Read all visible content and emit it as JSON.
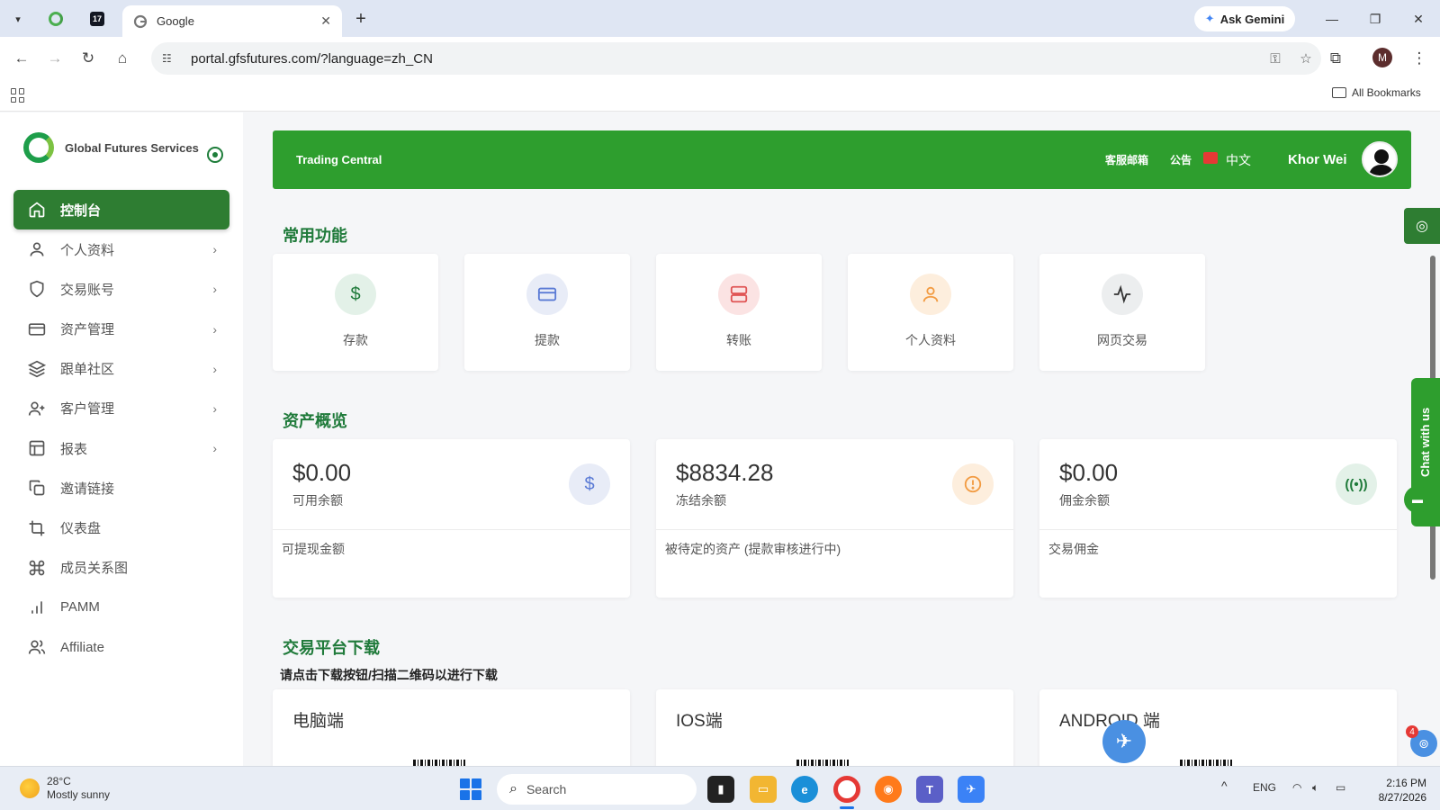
{
  "browser": {
    "active_tab_title": "Google",
    "new_tab_label": "+",
    "close_tab_label": "✕",
    "ask_gemini_label": "Ask Gemini",
    "url": "portal.gfsfutures.com/?language=zh_CN",
    "profile_initial": "M",
    "all_bookmarks_label": "All Bookmarks"
  },
  "sidebar": {
    "brand_name": "Global Futures Services",
    "items": [
      {
        "label": "控制台",
        "icon": "home-icon",
        "active": true,
        "has_chevron": false
      },
      {
        "label": "个人资料",
        "icon": "user-icon",
        "active": false,
        "has_chevron": true
      },
      {
        "label": "交易账号",
        "icon": "shield-icon",
        "active": false,
        "has_chevron": true
      },
      {
        "label": "资产管理",
        "icon": "credit-card-icon",
        "active": false,
        "has_chevron": true
      },
      {
        "label": "跟单社区",
        "icon": "layers-icon",
        "active": false,
        "has_chevron": true
      },
      {
        "label": "客户管理",
        "icon": "user-plus-icon",
        "active": false,
        "has_chevron": true
      },
      {
        "label": "报表",
        "icon": "table-icon",
        "active": false,
        "has_chevron": true
      },
      {
        "label": "邀请链接",
        "icon": "copy-icon",
        "active": false,
        "has_chevron": false
      },
      {
        "label": "仪表盘",
        "icon": "crop-icon",
        "active": false,
        "has_chevron": false
      },
      {
        "label": "成员关系图",
        "icon": "command-icon",
        "active": false,
        "has_chevron": false
      },
      {
        "label": "PAMM",
        "icon": "bar-chart-icon",
        "active": false,
        "has_chevron": false
      },
      {
        "label": "Affiliate",
        "icon": "users-icon",
        "active": false,
        "has_chevron": false
      }
    ]
  },
  "header": {
    "title": "Trading Central",
    "support_email_label": "客服邮箱",
    "announcement_label": "公告",
    "language_label": "中文",
    "username": "Khor Wei"
  },
  "quick_functions": {
    "title": "常用功能",
    "items": [
      {
        "label": "存款",
        "icon": "dollar-icon"
      },
      {
        "label": "提款",
        "icon": "credit-card-icon"
      },
      {
        "label": "转账",
        "icon": "server-icon"
      },
      {
        "label": "个人资料",
        "icon": "user-icon"
      },
      {
        "label": "网页交易",
        "icon": "activity-icon"
      }
    ]
  },
  "asset_overview": {
    "title": "资产概览",
    "cards": [
      {
        "amount": "$0.00",
        "label": "可用余额",
        "footer": "可提现金额",
        "icon": "dollar-icon"
      },
      {
        "amount": "$8834.28",
        "label": "冻结余额",
        "footer": "被待定的资产 (提款审核进行中)",
        "icon": "alert-circle-icon"
      },
      {
        "amount": "$0.00",
        "label": "佣金余额",
        "footer": "交易佣金",
        "icon": "broadcast-icon"
      }
    ]
  },
  "downloads": {
    "title": "交易平台下载",
    "subtitle": "请点击下载按钮/扫描二维码以进行下载",
    "cards": [
      {
        "title": "电脑端"
      },
      {
        "title": "IOS端"
      },
      {
        "title": "ANDROID 端"
      }
    ]
  },
  "chat": {
    "label": "Chat with us"
  },
  "notification_badge": "4",
  "taskbar": {
    "temperature": "28°C",
    "weather": "Mostly sunny",
    "search_placeholder": "Search",
    "language": "ENG",
    "time": "2:16 PM",
    "date": "8/27/2026"
  },
  "colors": {
    "brand_green": "#2e9e2e",
    "sidebar_active": "#2e7d32",
    "section_title": "#1f7a3a"
  }
}
